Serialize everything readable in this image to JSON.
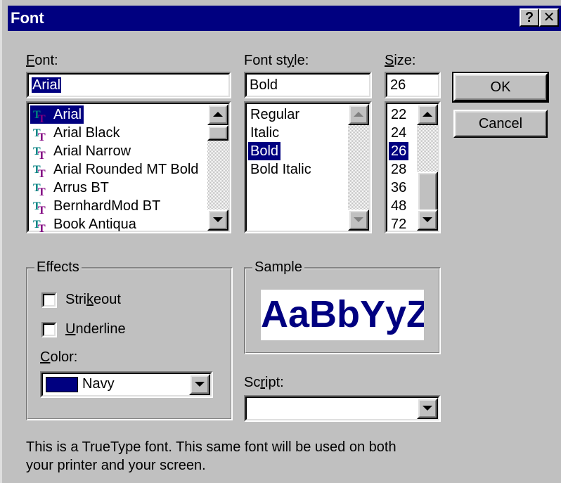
{
  "window": {
    "title": "Font",
    "help_label": "?",
    "close_label": "✕"
  },
  "font": {
    "label": "Font:",
    "value": "Arial",
    "items": [
      "Arial",
      "Arial Black",
      "Arial Narrow",
      "Arial Rounded MT Bold",
      "Arrus BT",
      "BernhardMod BT",
      "Book Antiqua"
    ],
    "selected": "Arial"
  },
  "style": {
    "label": "Font style:",
    "value": "Bold",
    "items": [
      "Regular",
      "Italic",
      "Bold",
      "Bold Italic"
    ],
    "selected": "Bold"
  },
  "size": {
    "label": "Size:",
    "value": "26",
    "items": [
      "22",
      "24",
      "26",
      "28",
      "36",
      "48",
      "72"
    ],
    "selected": "26"
  },
  "buttons": {
    "ok": "OK",
    "cancel": "Cancel"
  },
  "effects": {
    "label": "Effects",
    "strikeout": "Strikeout",
    "underline": "Underline",
    "color_label": "Color:",
    "color_value": "Navy",
    "color_hex": "#000080"
  },
  "sample": {
    "label": "Sample",
    "text": "AaBbYyZz"
  },
  "script": {
    "label": "Script:",
    "value": ""
  },
  "info": {
    "line1": "This is a TrueType font. This same font will be used on both",
    "line2": "your printer and your screen."
  },
  "colors": {
    "titlebar": "#000080",
    "selection": "#000080",
    "face": "#c0c0c0"
  },
  "icons": {
    "truetype": "truetype-icon"
  }
}
